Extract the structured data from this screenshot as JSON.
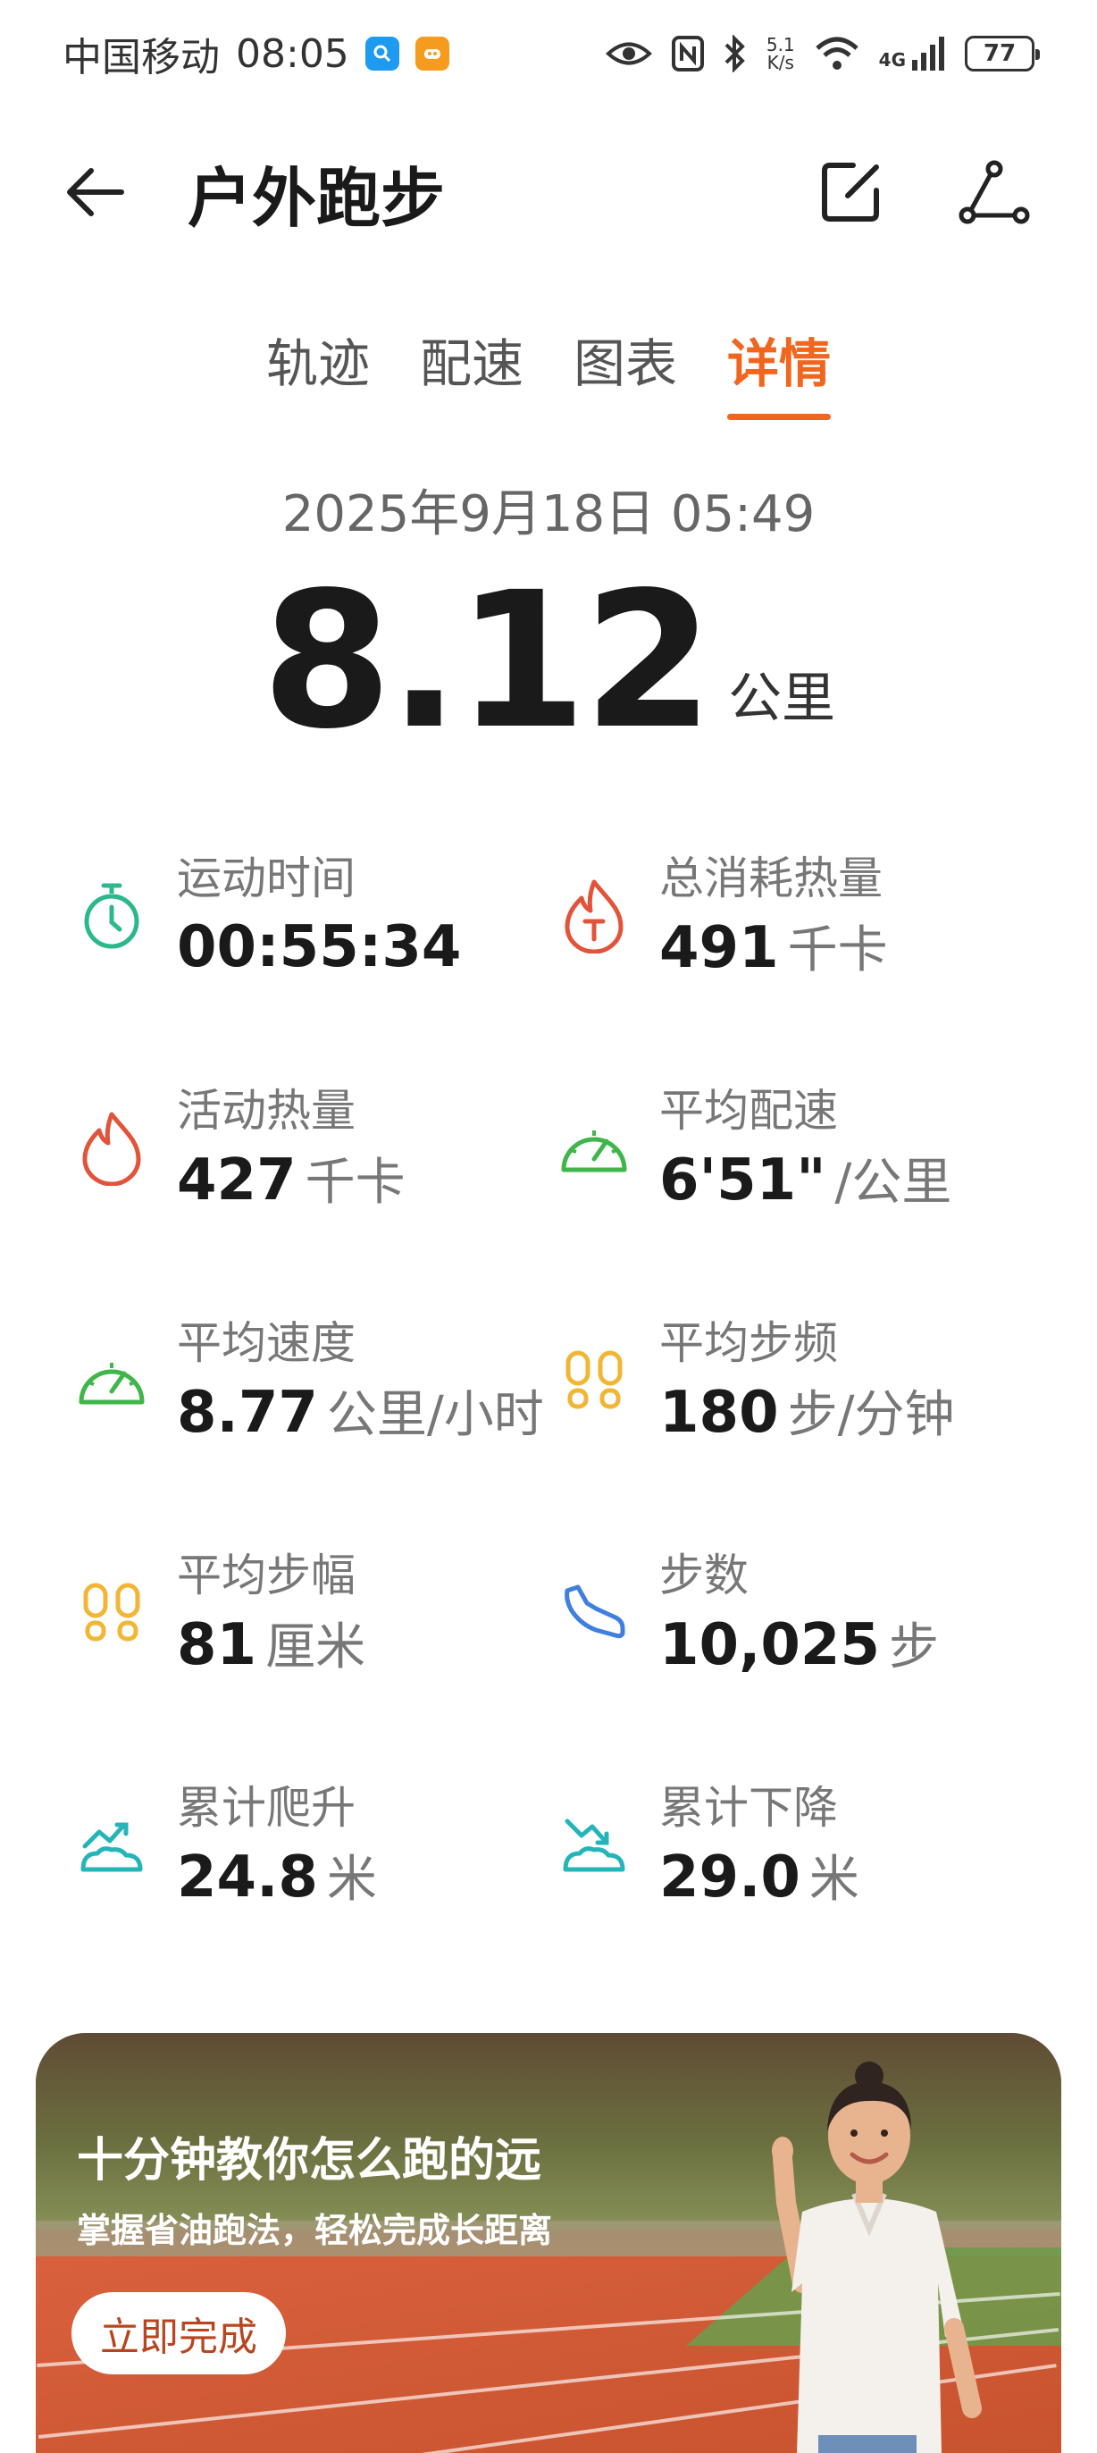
{
  "status_bar": {
    "carrier": "中国移动",
    "time": "08:05",
    "net_speed_value": "5.1",
    "net_speed_unit": "K/s",
    "network_type": "4G",
    "battery": "77"
  },
  "header": {
    "title": "户外跑步",
    "back_icon": "arrow-left-icon",
    "edit_icon": "edit-icon",
    "share_icon": "share-icon"
  },
  "tabs": [
    {
      "label": "轨迹",
      "active": false
    },
    {
      "label": "配速",
      "active": false
    },
    {
      "label": "图表",
      "active": false
    },
    {
      "label": "详情",
      "active": true
    }
  ],
  "summary": {
    "datetime": "2025年9月18日 05:49",
    "distance": "8.12",
    "distance_unit": "公里"
  },
  "stats": [
    {
      "label": "运动时间",
      "value": "00:55:34",
      "unit": "",
      "icon": "stopwatch-icon",
      "color": "#2bb88a"
    },
    {
      "label": "总消耗热量",
      "value": "491",
      "unit": "千卡",
      "icon": "total-calorie-icon",
      "color": "#e2533a"
    },
    {
      "label": "活动热量",
      "value": "427",
      "unit": "千卡",
      "icon": "flame-icon",
      "color": "#e2533a"
    },
    {
      "label": "平均配速",
      "value": "6'51\"",
      "unit": "/公里",
      "icon": "speedometer-icon",
      "color": "#3fb54a"
    },
    {
      "label": "平均速度",
      "value": "8.77",
      "unit": "公里/小时",
      "icon": "speedometer-icon",
      "color": "#3fb54a"
    },
    {
      "label": "平均步频",
      "value": "180",
      "unit": "步/分钟",
      "icon": "footprints-icon",
      "color": "#f2b534"
    },
    {
      "label": "平均步幅",
      "value": "81",
      "unit": "厘米",
      "icon": "footprints-icon",
      "color": "#f2b534"
    },
    {
      "label": "步数",
      "value": "10,025",
      "unit": "步",
      "icon": "shoe-icon",
      "color": "#3f7fe0"
    },
    {
      "label": "累计爬升",
      "value": "24.8",
      "unit": "米",
      "icon": "climb-icon",
      "color": "#24b5b8"
    },
    {
      "label": "累计下降",
      "value": "29.0",
      "unit": "米",
      "icon": "descent-icon",
      "color": "#24b5b8"
    }
  ],
  "banner": {
    "title": "十分钟教你怎么跑的远",
    "subtitle": "掌握省油跑法，轻松完成长距离",
    "button": "立即完成"
  },
  "colors": {
    "accent": "#f0661f"
  }
}
